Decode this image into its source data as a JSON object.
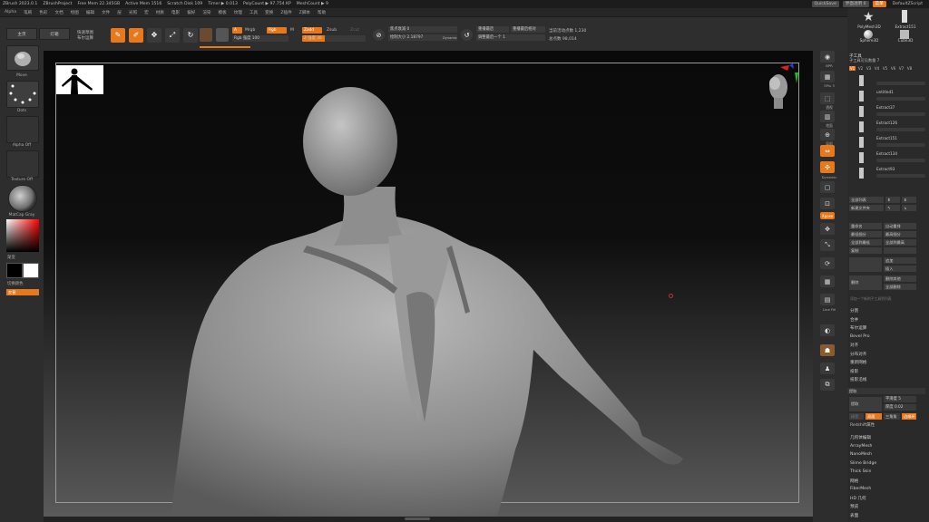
{
  "titlebar": {
    "app": "ZBrush 2023.0.1",
    "project": "ZBrushProject",
    "free_mem": "Free Mem 22.345GB",
    "active_mem": "Active Mem 1516",
    "scratch_disk": "Scratch Disk 109",
    "timer": "Timer ▶ 0.013",
    "poly_count": "PolyCount ▶ 97.754 KP",
    "mesh_count": "MeshCount ▶ 9",
    "quicksave": "QuickSave",
    "transparency": "界面透明 0",
    "menus_btn": "菜单",
    "script": "DefaultZScript"
  },
  "menubar": [
    "Alpha",
    "笔刷",
    "色彩",
    "文档",
    "绘图",
    "编辑",
    "文件",
    "层",
    "光照",
    "宏",
    "材质",
    "电影",
    "偏好",
    "渲染",
    "模板",
    "纹理",
    "工具",
    "变换",
    "Z插件",
    "Z脚本",
    "帮助"
  ],
  "topshelf": {
    "home_btn": "主页",
    "lightbox_btn": "灯箱",
    "quick_draw_btn": "快速草图",
    "boolean_btn": "布尔运算",
    "edit_btn": "Edit",
    "draw_btn": "Draw",
    "move_btn": "Move",
    "scale_btn": "Scale",
    "rotate_btn": "Rotate",
    "mrgb_a": "A",
    "mrgb": "Mrgb",
    "rgb": "Rgb",
    "m": "M",
    "zadd": "Zadd",
    "zsub": "Zsub",
    "zcut": "Zcut",
    "rgb_intensity": "Rgb 强度 100",
    "z_intensity": "Z 强度 36",
    "focal_shift": "焦点衰减 0",
    "draw_size": "绘制大小 2.18797",
    "dynamic": "Dynamic",
    "replay_last": "重播最后",
    "replay_last_rel": "重播最后相对",
    "adjust_last": "调整最后一个 1",
    "active_points": "当前活动点数 1,230",
    "total_points": "总点数 98,014"
  },
  "leftshelf": {
    "brush": "Move",
    "stroke": "Dots",
    "alpha": "Alpha Off",
    "texture": "Texture Off",
    "material": "MatCap Gray",
    "gradient": "渐变",
    "switch_color": "切换颜色",
    "swap": "交替"
  },
  "rightshelf": {
    "bpr": "BPR",
    "spix": "SPix 3",
    "persp": "透视",
    "floor": "地面",
    "local": "局部",
    "dynamic": "Dynamic",
    "transp": "透明",
    "lsym": "L.Sym",
    "xyz": "xyz",
    "frame": "框架",
    "move": "移动",
    "scale": "缩放",
    "rotate": "旋转",
    "polyf": "PolyF",
    "line_fill": "Line Fill",
    "transp2": "透明度",
    "ghost": "幽灵",
    "solo": "Solo",
    "xpose": "Xpose"
  },
  "panel": {
    "tools": [
      "PolyMesh3D",
      "Extract151",
      "Sphere3D",
      "Cube3D"
    ],
    "subtool_title": "子工具",
    "visible_count": "子工具可见数量 7",
    "tabs": [
      "V1",
      "V2",
      "V3",
      "V4",
      "V5",
      "V6",
      "V7",
      "V8"
    ],
    "subtools": [
      "",
      "untitled1",
      "Extract37",
      "Extract126",
      "Extract151",
      "Extract134",
      "Extract93"
    ],
    "buttons": [
      "全部列表",
      "新建文件夹",
      "重命名",
      "自动重排",
      "最低细分",
      "最高细分",
      "全部到最低",
      "全部到最高",
      "复制",
      "追加",
      "插入",
      "删除",
      "删除其他",
      "全部删除"
    ],
    "append_hint": "添加一个新的子工具到列表",
    "list1": [
      "分割",
      "合并",
      "布尔运算",
      "Bevel Pro",
      "对齐",
      "分布对齐",
      "重新网格",
      "投影",
      "投影沿线"
    ],
    "extract_title": "提取",
    "extract_btn": "提取",
    "smooth": "平滑度 5",
    "thickness": "厚度 0.02",
    "accept": "接受",
    "double": "双面",
    "tcorner": "三角角",
    "edge": "边缘环",
    "redshift": "Redshift属性",
    "list2": [
      "几何体编辑",
      "ArrayMesh",
      "NanoMesh",
      "Slime Bridge",
      "Thick Skin",
      "网格",
      "FiberMesh",
      "HD 几何",
      "预览",
      "表面"
    ]
  }
}
